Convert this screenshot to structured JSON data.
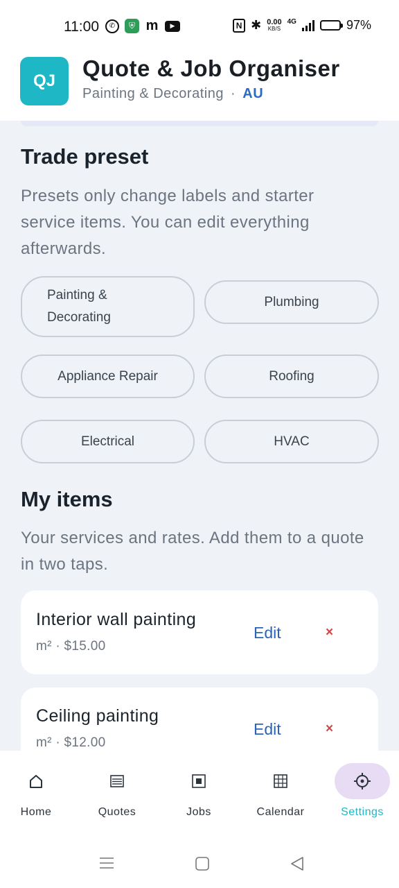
{
  "status_bar": {
    "time": "11:00",
    "net_speed": "0.00",
    "net_unit": "KB/S",
    "network": "4G",
    "battery": "97%"
  },
  "header": {
    "logo_text": "QJ",
    "title": "Quote & Job Organiser",
    "subtitle": "Painting & Decorating",
    "separator": "·",
    "region": "AU",
    "accent_color": "#1eb7c6"
  },
  "trade_preset": {
    "title": "Trade preset",
    "description": "Presets only change labels and starter service items. You can edit everything afterwards.",
    "options": [
      {
        "label": "Painting & Decorating"
      },
      {
        "label": "Plumbing"
      },
      {
        "label": "Appliance Repair"
      },
      {
        "label": "Roofing"
      },
      {
        "label": "Electrical"
      },
      {
        "label": "HVAC"
      }
    ]
  },
  "my_items": {
    "title": "My items",
    "description": "Your services and rates. Add them to a quote in two taps.",
    "edit_label": "Edit",
    "delete_label": "×",
    "items": [
      {
        "name": "Interior wall painting",
        "meta": "m² · $15.00"
      },
      {
        "name": "Ceiling painting",
        "meta": "m² · $12.00"
      }
    ]
  },
  "bottom_nav": {
    "items": [
      {
        "label": "Home",
        "icon": "home-icon"
      },
      {
        "label": "Quotes",
        "icon": "list-icon"
      },
      {
        "label": "Jobs",
        "icon": "square-icon"
      },
      {
        "label": "Calendar",
        "icon": "calendar-grid-icon"
      },
      {
        "label": "Settings",
        "icon": "gear-icon"
      }
    ],
    "active": "Settings"
  }
}
